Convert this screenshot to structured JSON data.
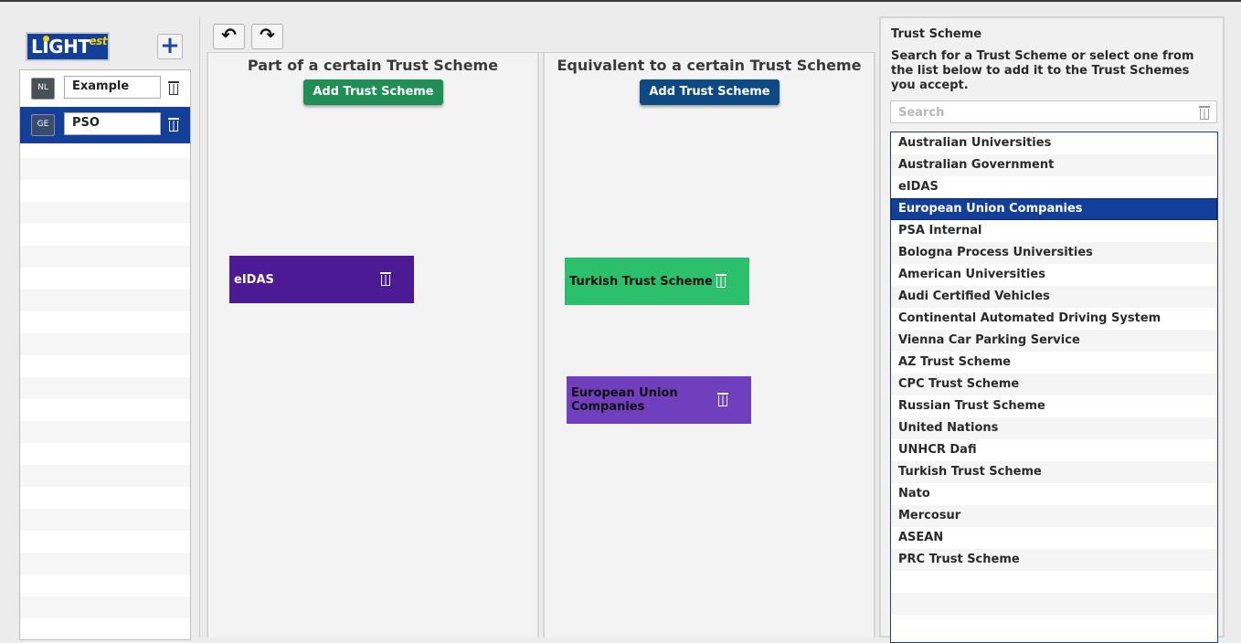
{
  "colors": {
    "brand_blue": "#123f9a",
    "add_green": "#1f8f55",
    "add_blue": "#0d4a84",
    "card_purple_dark": "#4d1a96",
    "card_green": "#2cc06d",
    "card_purple": "#6f3fbd"
  },
  "logo": {
    "main": "LIGHT",
    "sup": "est"
  },
  "left_panel": {
    "add_icon": "plus-icon",
    "policies": [
      {
        "lang": "NL",
        "name": "Example",
        "selected": false
      },
      {
        "lang": "GE",
        "name": "PSO",
        "selected": true
      }
    ]
  },
  "toolbar": {
    "undo_icon": "undo-icon",
    "redo_icon": "redo-icon",
    "undo_glyph": "↶",
    "redo_glyph": "↷"
  },
  "columns": {
    "part_of": {
      "title": "Part of a certain Trust Scheme",
      "add_label": "Add Trust Scheme",
      "cards": [
        {
          "label": "eIDAS"
        }
      ]
    },
    "equivalent": {
      "title": "Equivalent to a certain Trust Scheme",
      "add_label": "Add Trust Scheme",
      "cards": [
        {
          "label": "Turkish Trust Scheme"
        },
        {
          "label": "European Union Companies"
        }
      ]
    }
  },
  "right_panel": {
    "title": "Trust Scheme",
    "instructions": "Search for a Trust Scheme or select one from the list below to add it to the Trust Schemes you accept.",
    "search_placeholder": "Search",
    "search_value": "",
    "selected": "European Union Companies",
    "schemes": [
      "Australian Universities",
      "Australian Government",
      "eIDAS",
      "European Union Companies",
      "PSA Internal",
      "Bologna Process Universities",
      "American Universities",
      "Audi Certified Vehicles",
      "Continental Automated Driving System",
      "Vienna Car Parking Service",
      "AZ Trust Scheme",
      "CPC Trust Scheme",
      "Russian Trust Scheme",
      "United Nations",
      "UNHCR Dafi",
      "Turkish Trust Scheme",
      "Nato",
      "Mercosur",
      "ASEAN",
      "PRC Trust Scheme"
    ]
  }
}
